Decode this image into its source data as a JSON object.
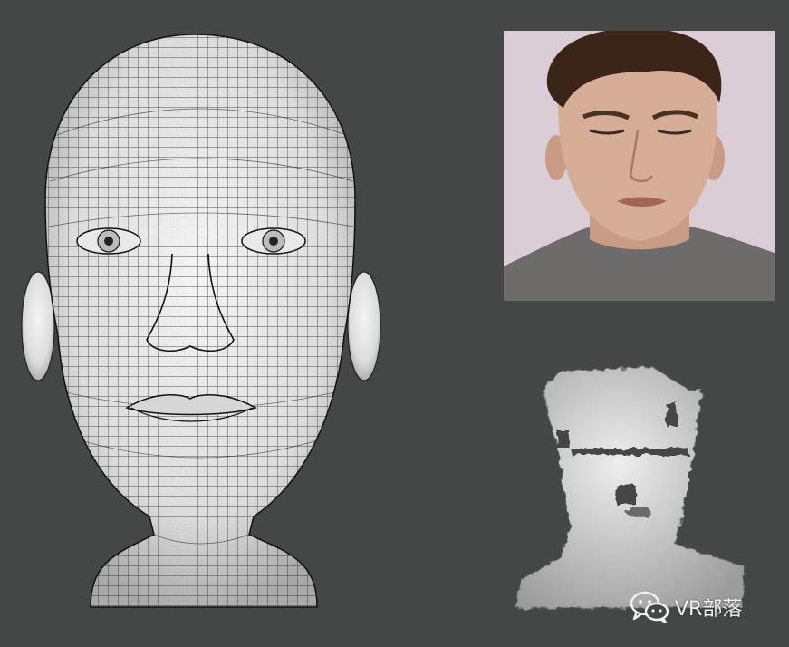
{
  "watermark": {
    "text": "VR部落",
    "icon": "wechat-icon"
  },
  "colors": {
    "background": "#444746",
    "mesh_skin": "#e9e9e9",
    "mesh_lines": "#1a1a1a",
    "photo_wall": "#d9ccd4",
    "shirt": "#6d6c6b",
    "scan_surface": "#d4d4d4"
  }
}
